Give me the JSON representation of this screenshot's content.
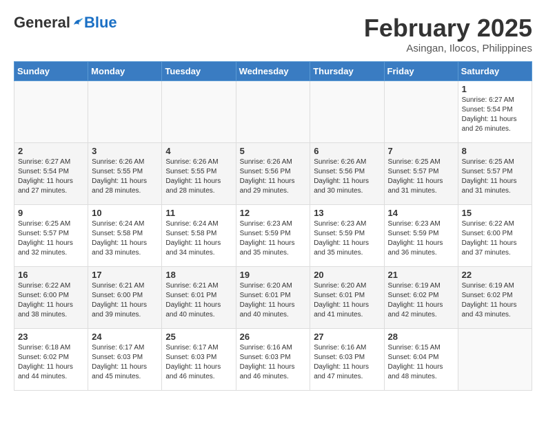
{
  "header": {
    "logo": {
      "general": "General",
      "blue": "Blue"
    },
    "title": "February 2025",
    "location": "Asingan, Ilocos, Philippines"
  },
  "calendar": {
    "days_of_week": [
      "Sunday",
      "Monday",
      "Tuesday",
      "Wednesday",
      "Thursday",
      "Friday",
      "Saturday"
    ],
    "weeks": [
      [
        {
          "day": "",
          "empty": true
        },
        {
          "day": "",
          "empty": true
        },
        {
          "day": "",
          "empty": true
        },
        {
          "day": "",
          "empty": true
        },
        {
          "day": "",
          "empty": true
        },
        {
          "day": "",
          "empty": true
        },
        {
          "day": "1",
          "sunrise": "6:27 AM",
          "sunset": "5:54 PM",
          "daylight": "11 hours and 26 minutes."
        }
      ],
      [
        {
          "day": "2",
          "sunrise": "6:27 AM",
          "sunset": "5:54 PM",
          "daylight": "11 hours and 27 minutes."
        },
        {
          "day": "3",
          "sunrise": "6:26 AM",
          "sunset": "5:55 PM",
          "daylight": "11 hours and 28 minutes."
        },
        {
          "day": "4",
          "sunrise": "6:26 AM",
          "sunset": "5:55 PM",
          "daylight": "11 hours and 28 minutes."
        },
        {
          "day": "5",
          "sunrise": "6:26 AM",
          "sunset": "5:56 PM",
          "daylight": "11 hours and 29 minutes."
        },
        {
          "day": "6",
          "sunrise": "6:26 AM",
          "sunset": "5:56 PM",
          "daylight": "11 hours and 30 minutes."
        },
        {
          "day": "7",
          "sunrise": "6:25 AM",
          "sunset": "5:57 PM",
          "daylight": "11 hours and 31 minutes."
        },
        {
          "day": "8",
          "sunrise": "6:25 AM",
          "sunset": "5:57 PM",
          "daylight": "11 hours and 31 minutes."
        }
      ],
      [
        {
          "day": "9",
          "sunrise": "6:25 AM",
          "sunset": "5:57 PM",
          "daylight": "11 hours and 32 minutes."
        },
        {
          "day": "10",
          "sunrise": "6:24 AM",
          "sunset": "5:58 PM",
          "daylight": "11 hours and 33 minutes."
        },
        {
          "day": "11",
          "sunrise": "6:24 AM",
          "sunset": "5:58 PM",
          "daylight": "11 hours and 34 minutes."
        },
        {
          "day": "12",
          "sunrise": "6:23 AM",
          "sunset": "5:59 PM",
          "daylight": "11 hours and 35 minutes."
        },
        {
          "day": "13",
          "sunrise": "6:23 AM",
          "sunset": "5:59 PM",
          "daylight": "11 hours and 35 minutes."
        },
        {
          "day": "14",
          "sunrise": "6:23 AM",
          "sunset": "5:59 PM",
          "daylight": "11 hours and 36 minutes."
        },
        {
          "day": "15",
          "sunrise": "6:22 AM",
          "sunset": "6:00 PM",
          "daylight": "11 hours and 37 minutes."
        }
      ],
      [
        {
          "day": "16",
          "sunrise": "6:22 AM",
          "sunset": "6:00 PM",
          "daylight": "11 hours and 38 minutes."
        },
        {
          "day": "17",
          "sunrise": "6:21 AM",
          "sunset": "6:00 PM",
          "daylight": "11 hours and 39 minutes."
        },
        {
          "day": "18",
          "sunrise": "6:21 AM",
          "sunset": "6:01 PM",
          "daylight": "11 hours and 40 minutes."
        },
        {
          "day": "19",
          "sunrise": "6:20 AM",
          "sunset": "6:01 PM",
          "daylight": "11 hours and 40 minutes."
        },
        {
          "day": "20",
          "sunrise": "6:20 AM",
          "sunset": "6:01 PM",
          "daylight": "11 hours and 41 minutes."
        },
        {
          "day": "21",
          "sunrise": "6:19 AM",
          "sunset": "6:02 PM",
          "daylight": "11 hours and 42 minutes."
        },
        {
          "day": "22",
          "sunrise": "6:19 AM",
          "sunset": "6:02 PM",
          "daylight": "11 hours and 43 minutes."
        }
      ],
      [
        {
          "day": "23",
          "sunrise": "6:18 AM",
          "sunset": "6:02 PM",
          "daylight": "11 hours and 44 minutes."
        },
        {
          "day": "24",
          "sunrise": "6:17 AM",
          "sunset": "6:03 PM",
          "daylight": "11 hours and 45 minutes."
        },
        {
          "day": "25",
          "sunrise": "6:17 AM",
          "sunset": "6:03 PM",
          "daylight": "11 hours and 46 minutes."
        },
        {
          "day": "26",
          "sunrise": "6:16 AM",
          "sunset": "6:03 PM",
          "daylight": "11 hours and 46 minutes."
        },
        {
          "day": "27",
          "sunrise": "6:16 AM",
          "sunset": "6:03 PM",
          "daylight": "11 hours and 47 minutes."
        },
        {
          "day": "28",
          "sunrise": "6:15 AM",
          "sunset": "6:04 PM",
          "daylight": "11 hours and 48 minutes."
        },
        {
          "day": "",
          "empty": true
        }
      ]
    ]
  }
}
